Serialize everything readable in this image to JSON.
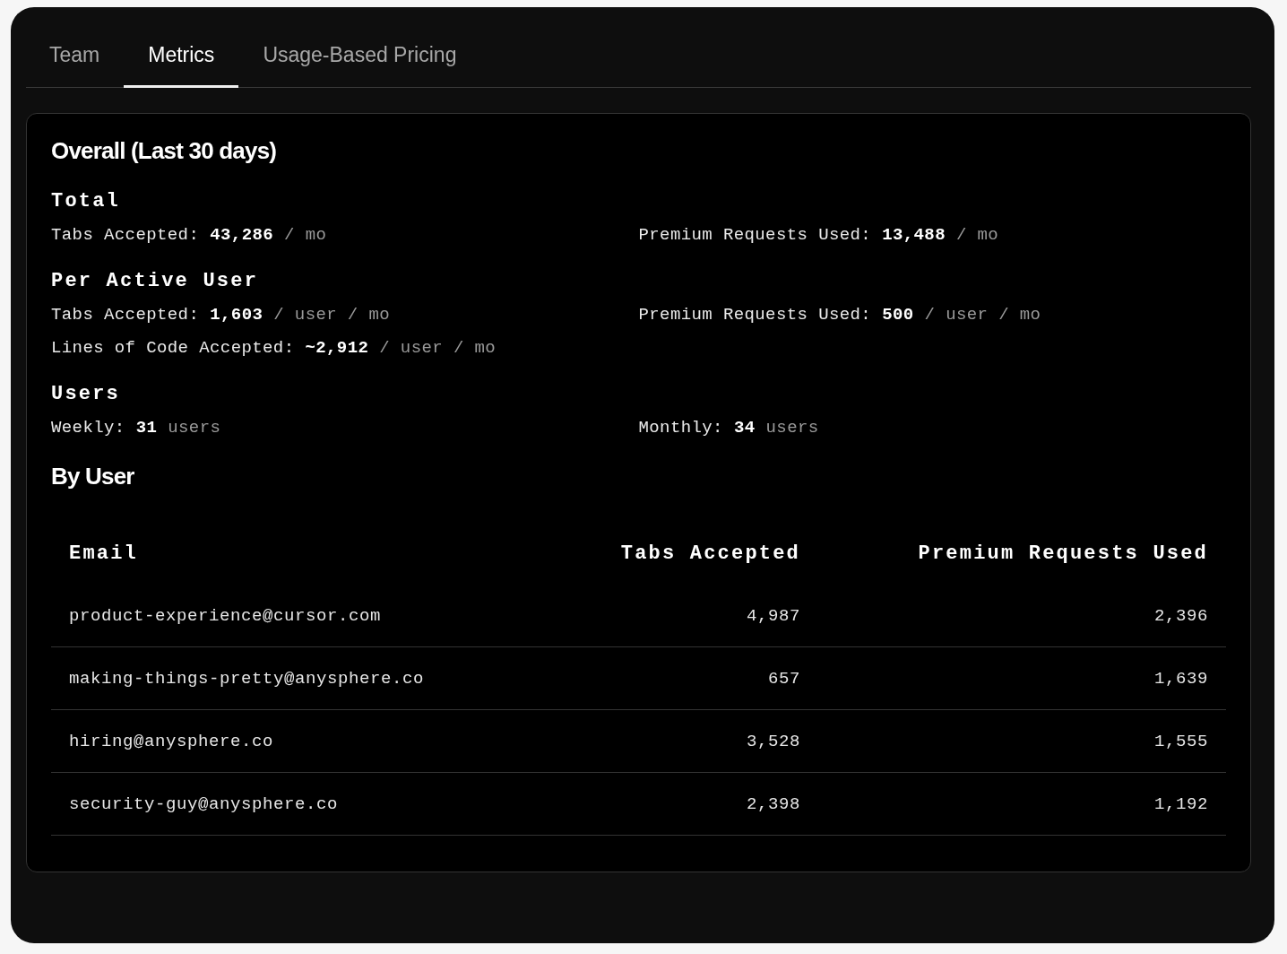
{
  "tabs": [
    {
      "label": "Team",
      "selected": false
    },
    {
      "label": "Metrics",
      "selected": true
    },
    {
      "label": "Usage-Based Pricing",
      "selected": false
    }
  ],
  "overall": {
    "title": "Overall (Last 30 days)",
    "groups": [
      {
        "title": "Total",
        "rows": [
          [
            {
              "label": "Tabs Accepted:",
              "value": "43,286",
              "unit": "/ mo"
            },
            {
              "label": "Premium Requests Used:",
              "value": "13,488",
              "unit": "/ mo"
            }
          ]
        ]
      },
      {
        "title": "Per Active User",
        "rows": [
          [
            {
              "label": "Tabs Accepted:",
              "value": "1,603",
              "unit": "/ user / mo"
            },
            {
              "label": "Premium Requests Used:",
              "value": "500",
              "unit": "/ user / mo"
            }
          ],
          [
            {
              "label": "Lines of Code Accepted:",
              "value": "~2,912",
              "unit": "/ user / mo"
            }
          ]
        ]
      },
      {
        "title": "Users",
        "rows": [
          [
            {
              "label": "Weekly:",
              "value": "31",
              "unit": "users"
            },
            {
              "label": "Monthly:",
              "value": "34",
              "unit": "users"
            }
          ]
        ]
      }
    ]
  },
  "by_user": {
    "title": "By User",
    "columns": [
      "Email",
      "Tabs Accepted",
      "Premium Requests Used"
    ],
    "rows": [
      [
        "product-experience@cursor.com",
        "4,987",
        "2,396"
      ],
      [
        "making-things-pretty@anysphere.co",
        "657",
        "1,639"
      ],
      [
        "hiring@anysphere.co",
        "3,528",
        "1,555"
      ],
      [
        "security-guy@anysphere.co",
        "2,398",
        "1,192"
      ]
    ]
  }
}
